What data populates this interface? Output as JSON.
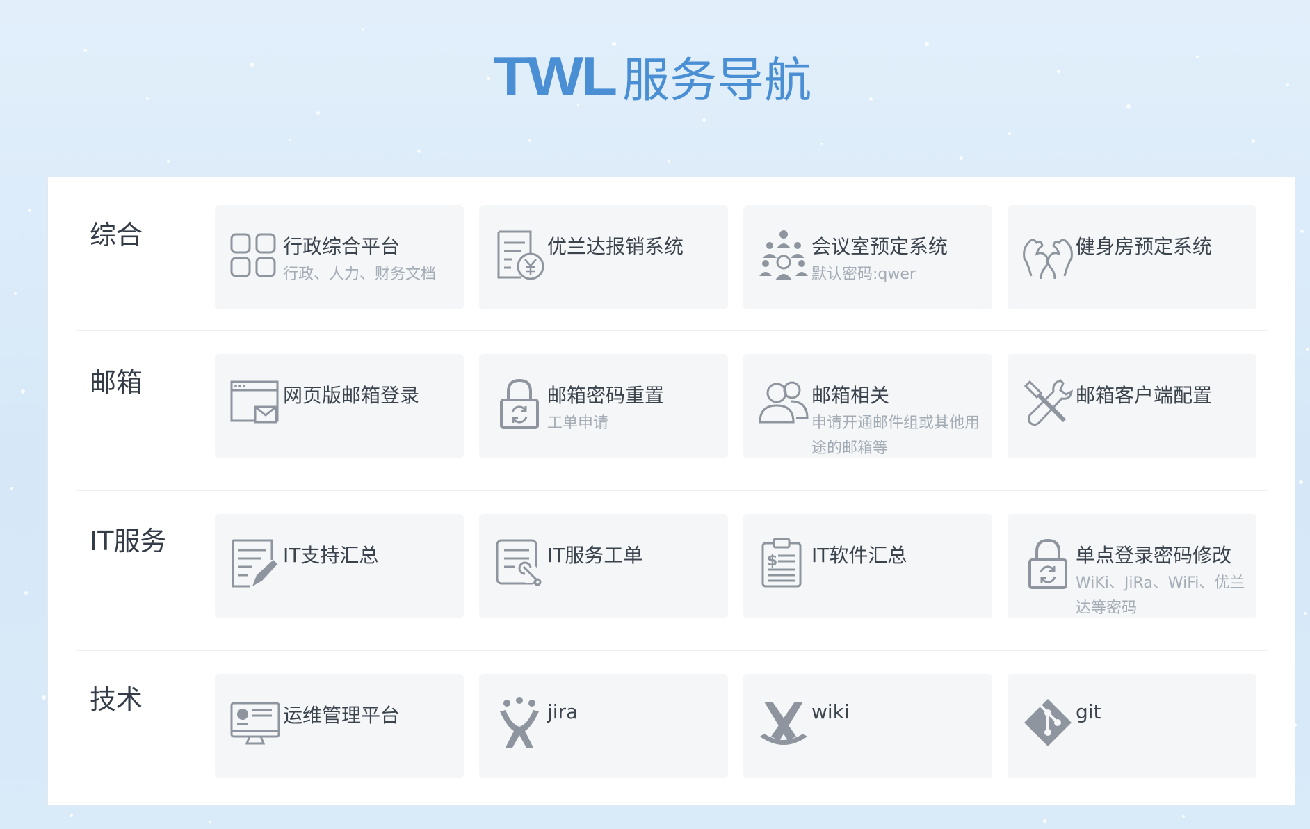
{
  "header": {
    "brand": "TWL",
    "title": "服务导航"
  },
  "colors": {
    "accent": "#4a8fd4",
    "card_bg": "#f4f6f8",
    "icon": "#8e959e"
  },
  "sections": [
    {
      "label": "综合",
      "cards": [
        {
          "title": "行政综合平台",
          "subtitle": "行政、人力、财务文档",
          "icon": "grid-squares-icon"
        },
        {
          "title": "优兰达报销系统",
          "subtitle": "",
          "icon": "expense-yen-icon"
        },
        {
          "title": "会议室预定系统",
          "subtitle": "默认密码:qwer",
          "icon": "meeting-people-icon"
        },
        {
          "title": "健身房预定系统",
          "subtitle": "",
          "icon": "muscle-arms-icon"
        }
      ]
    },
    {
      "label": "邮箱",
      "cards": [
        {
          "title": "网页版邮箱登录",
          "subtitle": "",
          "icon": "web-mail-icon"
        },
        {
          "title": "邮箱密码重置",
          "subtitle": "工单申请",
          "icon": "lock-refresh-icon"
        },
        {
          "title": "邮箱相关",
          "subtitle": "申请开通邮件组或其他用途的邮箱等",
          "icon": "users-group-icon"
        },
        {
          "title": "邮箱客户端配置",
          "subtitle": "",
          "icon": "tools-icon"
        }
      ]
    },
    {
      "label": "IT服务",
      "cards": [
        {
          "title": "IT支持汇总",
          "subtitle": "",
          "icon": "document-pen-icon"
        },
        {
          "title": "IT服务工单",
          "subtitle": "",
          "icon": "ticket-wrench-icon"
        },
        {
          "title": "IT软件汇总",
          "subtitle": "",
          "icon": "clipboard-dollar-icon"
        },
        {
          "title": "单点登录密码修改",
          "subtitle": "WiKi、JiRa、WiFi、优兰达等密码",
          "icon": "lock-refresh-icon"
        }
      ]
    },
    {
      "label": "技术",
      "cards": [
        {
          "title": "运维管理平台",
          "subtitle": "",
          "icon": "monitor-dashboard-icon"
        },
        {
          "title": "jira",
          "subtitle": "",
          "icon": "jira-icon"
        },
        {
          "title": "wiki",
          "subtitle": "",
          "icon": "confluence-icon"
        },
        {
          "title": "git",
          "subtitle": "",
          "icon": "git-icon"
        }
      ]
    }
  ]
}
